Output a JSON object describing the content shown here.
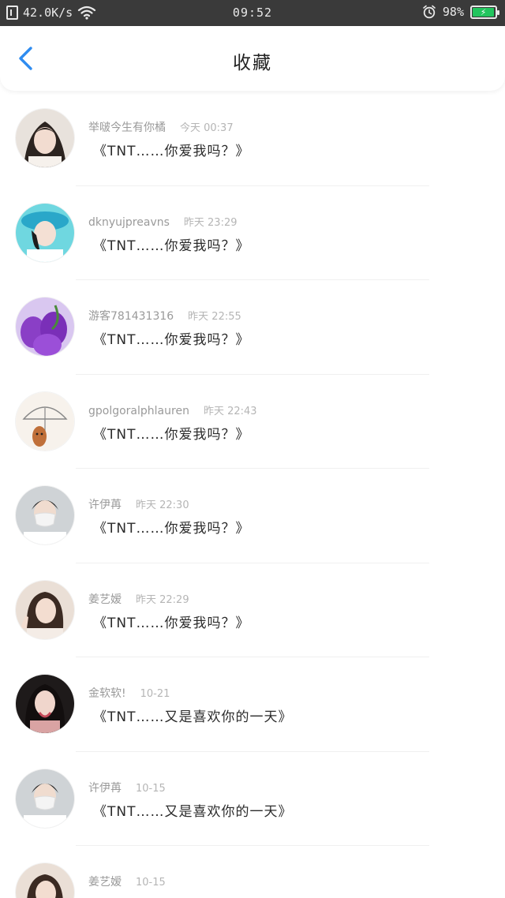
{
  "status_bar": {
    "net_speed": "42.0K/s",
    "time": "09:52",
    "battery": "98%",
    "battery_level": 0.98,
    "icons": [
      "phone-icon",
      "wifi-icon",
      "alarm-icon",
      "battery-icon"
    ]
  },
  "header": {
    "title": "收藏",
    "back_icon": "chevron-left-icon",
    "accent": "#2f8cf0"
  },
  "items": [
    {
      "name": "举啵今生有你橘",
      "time": "今天 00:37",
      "message": "《TNT……你爱我吗？》",
      "avatar": "girl-bob-hair"
    },
    {
      "name": "dknyujpreavns",
      "time": "昨天 23:29",
      "message": "《TNT……你爱我吗？》",
      "avatar": "blue-hat-girl"
    },
    {
      "name": "游客781431316",
      "time": "昨天 22:55",
      "message": "《TNT……你爱我吗？》",
      "avatar": "purple-tulips"
    },
    {
      "name": "gpolgoralphlauren",
      "time": "昨天 22:43",
      "message": "《TNT……你爱我吗？》",
      "avatar": "umbrella-drawing"
    },
    {
      "name": "许伊苒",
      "time": "昨天 22:30",
      "message": "《TNT……你爱我吗？》",
      "avatar": "masked-boy"
    },
    {
      "name": "姜艺嫒",
      "time": "昨天 22:29",
      "message": "《TNT……你爱我吗？》",
      "avatar": "girl-peace-sign"
    },
    {
      "name": "金软软!",
      "time": "10-21",
      "message": "《TNT……又是喜欢你的一天》",
      "avatar": "dark-hair-girl"
    },
    {
      "name": "许伊苒",
      "time": "10-15",
      "message": "《TNT……又是喜欢你的一天》",
      "avatar": "masked-boy"
    },
    {
      "name": "姜艺嫒",
      "time": "10-15",
      "message": "",
      "avatar": "girl-peace-sign"
    }
  ]
}
